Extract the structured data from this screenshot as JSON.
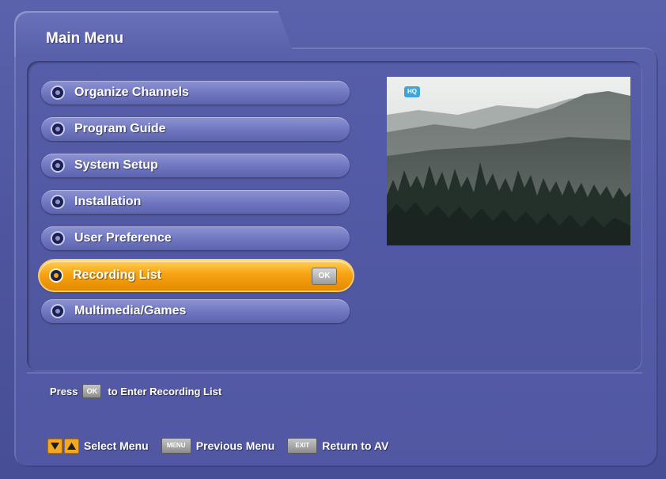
{
  "header": {
    "title": "Main Menu"
  },
  "menu": {
    "items": [
      {
        "label": "Organize Channels",
        "selected": false
      },
      {
        "label": "Program Guide",
        "selected": false
      },
      {
        "label": "System Setup",
        "selected": false
      },
      {
        "label": "Installation",
        "selected": false
      },
      {
        "label": "User Preference",
        "selected": false
      },
      {
        "label": "Recording List",
        "selected": true
      },
      {
        "label": "Multimedia/Games",
        "selected": false
      }
    ],
    "ok_badge": "OK"
  },
  "preview": {
    "badge": "HQ"
  },
  "help": {
    "prefix": "Press",
    "key": "OK",
    "suffix": "to Enter Recording List"
  },
  "footer": {
    "select_label": "Select Menu",
    "menu_key": "MENU",
    "previous_label": "Previous Menu",
    "exit_key": "EXIT",
    "return_label": "Return to AV"
  },
  "colors": {
    "background": "#4f56a0",
    "highlight": "#f7a312",
    "text": "#ffffff"
  }
}
